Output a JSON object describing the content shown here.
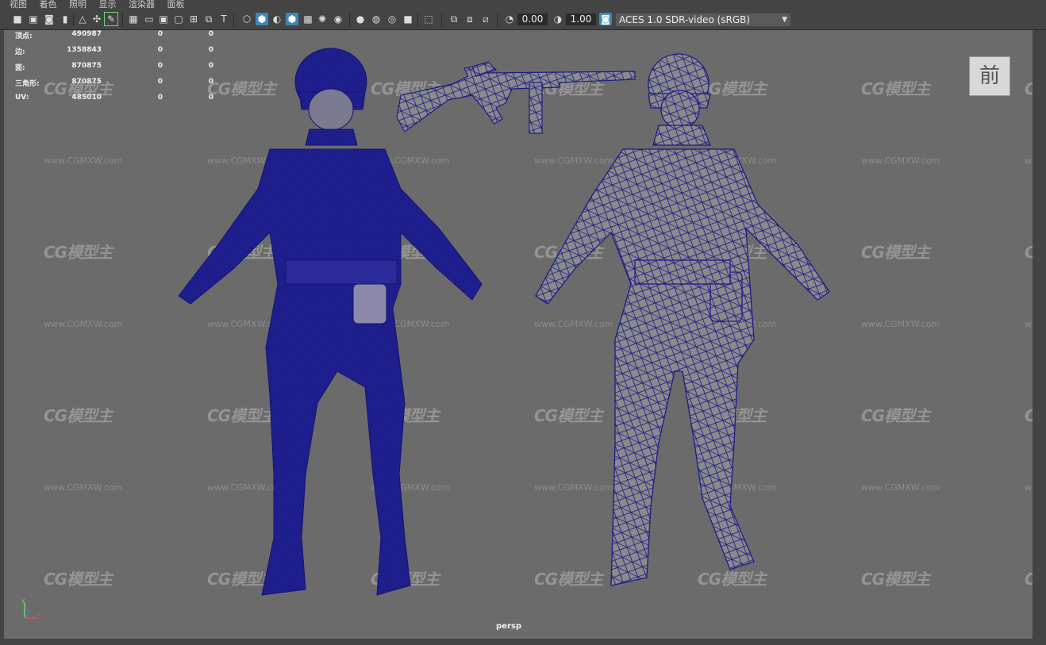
{
  "menu": [
    "视图",
    "着色",
    "照明",
    "显示",
    "渲染器",
    "面板"
  ],
  "toolbar": {
    "exposure_value": "0.00",
    "gamma_value": "1.00",
    "color_space": "ACES 1.0 SDR-video (sRGB)"
  },
  "hud": {
    "rows": [
      {
        "label": "顶点:",
        "v1": "490987",
        "v2": "0",
        "v3": "0"
      },
      {
        "label": "边:",
        "v1": "1358843",
        "v2": "0",
        "v3": "0"
      },
      {
        "label": "面:",
        "v1": "870875",
        "v2": "0",
        "v3": "0"
      },
      {
        "label": "三角形:",
        "v1": "870875",
        "v2": "0",
        "v3": "0"
      },
      {
        "label": "UV:",
        "v1": "485010",
        "v2": "0",
        "v3": "0"
      }
    ]
  },
  "view_cube_label": "前",
  "camera_label": "persp",
  "watermark": {
    "logo": "CG模型主",
    "url": "www.CGMXW.com"
  },
  "axis": {
    "x": "x",
    "y": "y",
    "z": "z"
  },
  "colors": {
    "viewport_bg": "#6b6b6b",
    "wire_blue": "#1c1c8a",
    "mesh_grey": "#8a8a8a",
    "ui_bg": "#444444",
    "active_blue": "#3b88b5"
  }
}
